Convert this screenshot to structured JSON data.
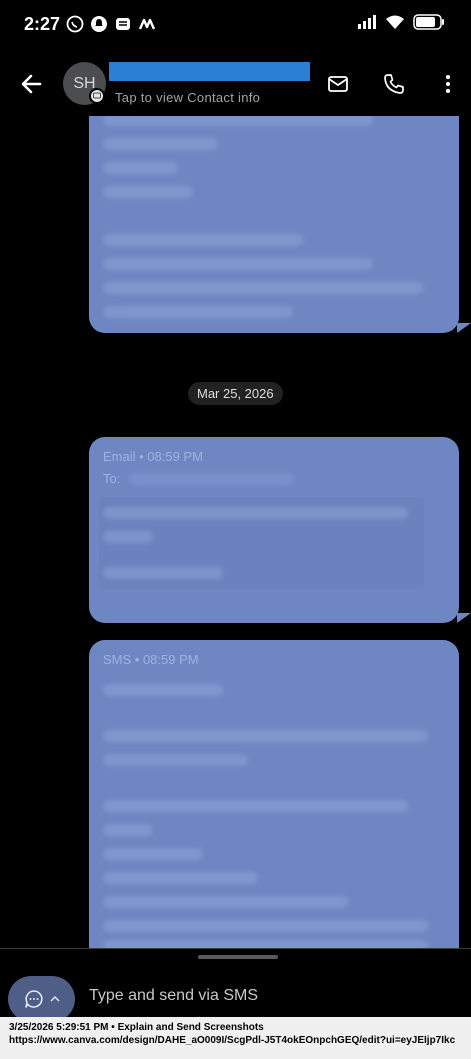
{
  "status_bar": {
    "time": "2:27",
    "apps": [
      "whatsapp-icon",
      "snapchat-icon",
      "stack-icon",
      "m-app-icon"
    ],
    "indicators": [
      "signal-icon",
      "wifi-icon",
      "battery-icon"
    ]
  },
  "header": {
    "avatar_initials": "SH",
    "contact_subtitle": "Tap to view Contact info",
    "actions": [
      "email-icon",
      "phone-icon",
      "more-icon"
    ]
  },
  "conversation": {
    "date_divider": "Mar 25, 2026",
    "email_message": {
      "meta": "Email • 08:59 PM",
      "to_label": "To:"
    },
    "sms_message": {
      "meta": "SMS • 08:59 PM"
    }
  },
  "composer": {
    "placeholder": "Type and send via SMS"
  },
  "caption": {
    "line1": "3/25/2026 5:29:51 PM • Explain and Send Screenshots",
    "line2": "https://www.canva.com/design/DAHE_aO009I/ScgPdl-J5T4okEOnpchGEQ/edit?ui=eyJEIjp7Ikc"
  },
  "colors": {
    "bubble": "#6e87c3",
    "redaction": "#2a7fd4",
    "background": "#000000"
  }
}
